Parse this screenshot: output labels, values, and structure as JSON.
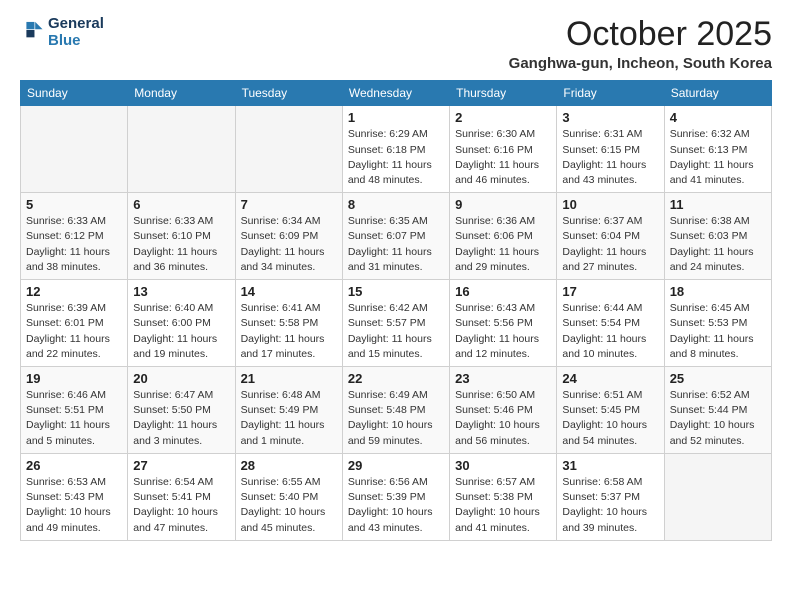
{
  "logo": {
    "line1": "General",
    "line2": "Blue"
  },
  "title": "October 2025",
  "location": "Ganghwa-gun, Incheon, South Korea",
  "days_of_week": [
    "Sunday",
    "Monday",
    "Tuesday",
    "Wednesday",
    "Thursday",
    "Friday",
    "Saturday"
  ],
  "weeks": [
    [
      {
        "empty": true
      },
      {
        "empty": true
      },
      {
        "empty": true
      },
      {
        "num": "1",
        "sunrise": "Sunrise: 6:29 AM",
        "sunset": "Sunset: 6:18 PM",
        "daylight": "Daylight: 11 hours and 48 minutes."
      },
      {
        "num": "2",
        "sunrise": "Sunrise: 6:30 AM",
        "sunset": "Sunset: 6:16 PM",
        "daylight": "Daylight: 11 hours and 46 minutes."
      },
      {
        "num": "3",
        "sunrise": "Sunrise: 6:31 AM",
        "sunset": "Sunset: 6:15 PM",
        "daylight": "Daylight: 11 hours and 43 minutes."
      },
      {
        "num": "4",
        "sunrise": "Sunrise: 6:32 AM",
        "sunset": "Sunset: 6:13 PM",
        "daylight": "Daylight: 11 hours and 41 minutes."
      }
    ],
    [
      {
        "num": "5",
        "sunrise": "Sunrise: 6:33 AM",
        "sunset": "Sunset: 6:12 PM",
        "daylight": "Daylight: 11 hours and 38 minutes."
      },
      {
        "num": "6",
        "sunrise": "Sunrise: 6:33 AM",
        "sunset": "Sunset: 6:10 PM",
        "daylight": "Daylight: 11 hours and 36 minutes."
      },
      {
        "num": "7",
        "sunrise": "Sunrise: 6:34 AM",
        "sunset": "Sunset: 6:09 PM",
        "daylight": "Daylight: 11 hours and 34 minutes."
      },
      {
        "num": "8",
        "sunrise": "Sunrise: 6:35 AM",
        "sunset": "Sunset: 6:07 PM",
        "daylight": "Daylight: 11 hours and 31 minutes."
      },
      {
        "num": "9",
        "sunrise": "Sunrise: 6:36 AM",
        "sunset": "Sunset: 6:06 PM",
        "daylight": "Daylight: 11 hours and 29 minutes."
      },
      {
        "num": "10",
        "sunrise": "Sunrise: 6:37 AM",
        "sunset": "Sunset: 6:04 PM",
        "daylight": "Daylight: 11 hours and 27 minutes."
      },
      {
        "num": "11",
        "sunrise": "Sunrise: 6:38 AM",
        "sunset": "Sunset: 6:03 PM",
        "daylight": "Daylight: 11 hours and 24 minutes."
      }
    ],
    [
      {
        "num": "12",
        "sunrise": "Sunrise: 6:39 AM",
        "sunset": "Sunset: 6:01 PM",
        "daylight": "Daylight: 11 hours and 22 minutes."
      },
      {
        "num": "13",
        "sunrise": "Sunrise: 6:40 AM",
        "sunset": "Sunset: 6:00 PM",
        "daylight": "Daylight: 11 hours and 19 minutes."
      },
      {
        "num": "14",
        "sunrise": "Sunrise: 6:41 AM",
        "sunset": "Sunset: 5:58 PM",
        "daylight": "Daylight: 11 hours and 17 minutes."
      },
      {
        "num": "15",
        "sunrise": "Sunrise: 6:42 AM",
        "sunset": "Sunset: 5:57 PM",
        "daylight": "Daylight: 11 hours and 15 minutes."
      },
      {
        "num": "16",
        "sunrise": "Sunrise: 6:43 AM",
        "sunset": "Sunset: 5:56 PM",
        "daylight": "Daylight: 11 hours and 12 minutes."
      },
      {
        "num": "17",
        "sunrise": "Sunrise: 6:44 AM",
        "sunset": "Sunset: 5:54 PM",
        "daylight": "Daylight: 11 hours and 10 minutes."
      },
      {
        "num": "18",
        "sunrise": "Sunrise: 6:45 AM",
        "sunset": "Sunset: 5:53 PM",
        "daylight": "Daylight: 11 hours and 8 minutes."
      }
    ],
    [
      {
        "num": "19",
        "sunrise": "Sunrise: 6:46 AM",
        "sunset": "Sunset: 5:51 PM",
        "daylight": "Daylight: 11 hours and 5 minutes."
      },
      {
        "num": "20",
        "sunrise": "Sunrise: 6:47 AM",
        "sunset": "Sunset: 5:50 PM",
        "daylight": "Daylight: 11 hours and 3 minutes."
      },
      {
        "num": "21",
        "sunrise": "Sunrise: 6:48 AM",
        "sunset": "Sunset: 5:49 PM",
        "daylight": "Daylight: 11 hours and 1 minute."
      },
      {
        "num": "22",
        "sunrise": "Sunrise: 6:49 AM",
        "sunset": "Sunset: 5:48 PM",
        "daylight": "Daylight: 10 hours and 59 minutes."
      },
      {
        "num": "23",
        "sunrise": "Sunrise: 6:50 AM",
        "sunset": "Sunset: 5:46 PM",
        "daylight": "Daylight: 10 hours and 56 minutes."
      },
      {
        "num": "24",
        "sunrise": "Sunrise: 6:51 AM",
        "sunset": "Sunset: 5:45 PM",
        "daylight": "Daylight: 10 hours and 54 minutes."
      },
      {
        "num": "25",
        "sunrise": "Sunrise: 6:52 AM",
        "sunset": "Sunset: 5:44 PM",
        "daylight": "Daylight: 10 hours and 52 minutes."
      }
    ],
    [
      {
        "num": "26",
        "sunrise": "Sunrise: 6:53 AM",
        "sunset": "Sunset: 5:43 PM",
        "daylight": "Daylight: 10 hours and 49 minutes."
      },
      {
        "num": "27",
        "sunrise": "Sunrise: 6:54 AM",
        "sunset": "Sunset: 5:41 PM",
        "daylight": "Daylight: 10 hours and 47 minutes."
      },
      {
        "num": "28",
        "sunrise": "Sunrise: 6:55 AM",
        "sunset": "Sunset: 5:40 PM",
        "daylight": "Daylight: 10 hours and 45 minutes."
      },
      {
        "num": "29",
        "sunrise": "Sunrise: 6:56 AM",
        "sunset": "Sunset: 5:39 PM",
        "daylight": "Daylight: 10 hours and 43 minutes."
      },
      {
        "num": "30",
        "sunrise": "Sunrise: 6:57 AM",
        "sunset": "Sunset: 5:38 PM",
        "daylight": "Daylight: 10 hours and 41 minutes."
      },
      {
        "num": "31",
        "sunrise": "Sunrise: 6:58 AM",
        "sunset": "Sunset: 5:37 PM",
        "daylight": "Daylight: 10 hours and 39 minutes."
      },
      {
        "empty": true
      }
    ]
  ]
}
